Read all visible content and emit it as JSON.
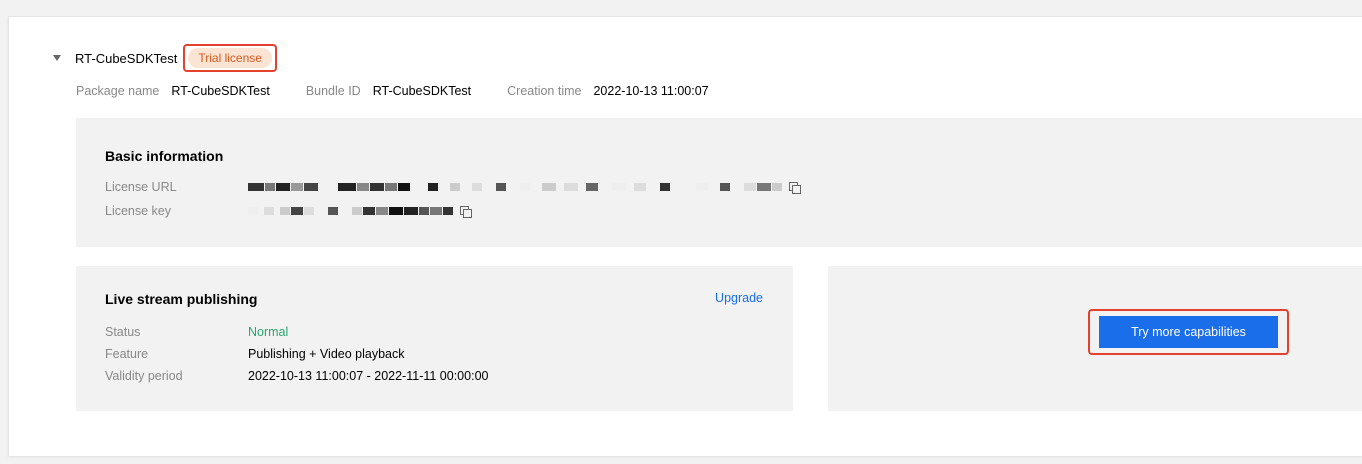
{
  "header": {
    "app_name": "RT-CubeSDKTest",
    "badge": "Trial license"
  },
  "meta": {
    "package_label": "Package name",
    "package_value": "RT-CubeSDKTest",
    "bundle_label": "Bundle ID",
    "bundle_value": "RT-CubeSDKTest",
    "creation_label": "Creation time",
    "creation_value": "2022-10-13 11:00:07"
  },
  "basic": {
    "title": "Basic information",
    "url_label": "License URL",
    "key_label": "License key"
  },
  "live": {
    "title": "Live stream publishing",
    "upgrade": "Upgrade",
    "status_label": "Status",
    "status_value": "Normal",
    "feature_label": "Feature",
    "feature_value": "Publishing + Video playback",
    "validity_label": "Validity period",
    "validity_value": "2022-10-13 11:00:07 - 2022-11-11 00:00:00"
  },
  "try": {
    "button": "Try more capabilities"
  },
  "icons": {
    "expand": "caret-down-icon",
    "copy": "copy-icon"
  },
  "colors": {
    "accent": "#1a6eea",
    "status_ok": "#2ba471",
    "highlight": "#e4412e",
    "badge_bg": "#fbe4d3",
    "badge_text": "#d65a1f"
  }
}
